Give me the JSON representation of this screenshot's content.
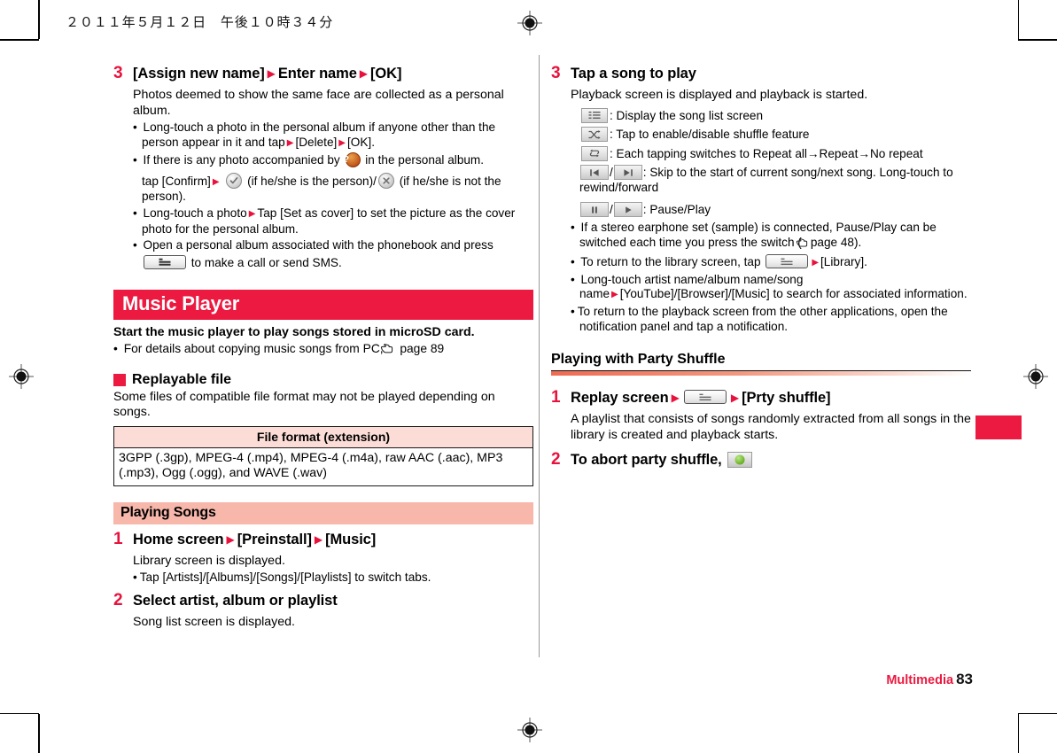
{
  "header": {
    "date_line": "２０１１年５月１２日　午後１０時３４分"
  },
  "footer": {
    "chapter": "Multimedia",
    "page_number": "83"
  },
  "colors": {
    "accent_red": "#ec1940",
    "step_number_red": "#e8123c",
    "band_pink": "#f7b7ab",
    "table_header_pink": "#fbdcd6"
  },
  "left_column": {
    "step3": {
      "num": "3",
      "title_a": "[Assign new name]",
      "title_b": "Enter name",
      "title_c": "[OK]",
      "para": "Photos deemed to show the same face are collected as a personal album.",
      "bullet1_a": "Long-touch a photo in the personal album if anyone other than the person appear in it and tap",
      "bullet1_b": "[Delete]",
      "bullet1_c": "[OK].",
      "bullet2_a": "If there is any photo accompanied by",
      "bullet2_b": "in the personal album.",
      "bullet2_line2_a": "tap [Confirm]",
      "bullet2_line2_b": "(if he/she is the person)/",
      "bullet2_line2_c": "(if he/she is not the person).",
      "bullet3_a": "Long-touch a photo",
      "bullet3_b": "Tap [Set as cover] to set the picture as the cover photo for the personal album.",
      "bullet4_a": "Open a personal album associated with the phonebook and press",
      "bullet4_b": "to make a call or send SMS."
    },
    "music_player": {
      "banner": "Music Player",
      "lead": "Start the music player to play songs stored in microSD card.",
      "bullet_a": "For details about copying music songs from PC,",
      "bullet_b": "page 89",
      "replayable_head": "Replayable file",
      "replayable_para": "Some files of compatible file format may not be played depending on songs.",
      "table": {
        "header": "File format (extension)",
        "row": "3GPP (.3gp), MPEG-4 (.mp4), MPEG-4 (.m4a), raw AAC (.aac), MP3 (.mp3), Ogg (.ogg), and WAVE (.wav)"
      }
    },
    "playing_songs": {
      "band": "Playing Songs",
      "step1": {
        "num": "1",
        "title_a": "Home screen",
        "title_b": "[Preinstall]",
        "title_c": "[Music]",
        "para": "Library screen is displayed.",
        "bullet": "Tap [Artists]/[Albums]/[Songs]/[Playlists] to switch tabs."
      },
      "step2": {
        "num": "2",
        "title": "Select artist, album or playlist",
        "para": "Song list screen is displayed."
      }
    }
  },
  "right_column": {
    "step3": {
      "num": "3",
      "title": "Tap a song to play",
      "para": "Playback screen is displayed and playback is started.",
      "icon_list": "icon: Display the song list screen",
      "icon_list_text": ": Display the song list screen",
      "icon_shuffle_text": ": Tap to enable/disable shuffle feature",
      "icon_repeat_text": ": Each tapping switches to Repeat all→Repeat→No repeat",
      "icon_skip_text": ": Skip to the start of current song/next song. Long-touch to rewind/forward",
      "icon_pause_text": ": Pause/Play",
      "bullet1_a": "If a stereo earphone set (sample) is connected, Pause/Play can be switched each time you press the switch (",
      "bullet1_b": "page 48).",
      "bullet2_a": "To return to the library screen, tap",
      "bullet2_b": "[Library].",
      "bullet3_a": "Long-touch artist name/album name/song name",
      "bullet3_b": "[YouTube]/[Browser]/[Music] to search for associated information.",
      "bullet4": "To return to the playback screen from the other applications, open the notification panel and tap a notification."
    },
    "party_shuffle": {
      "heading": "Playing with Party Shuffle",
      "step1": {
        "num": "1",
        "title_a": "Replay screen",
        "title_b": "[Prty shuffle]",
        "para": "A playlist that consists of songs randomly extracted from all songs in the library is created and playback starts."
      },
      "step2": {
        "num": "2",
        "title": "To abort party shuffle,"
      }
    }
  },
  "glyphs": {
    "arrow": "▶",
    "arrow_black": "→",
    "slash": "/",
    "question": "?"
  }
}
